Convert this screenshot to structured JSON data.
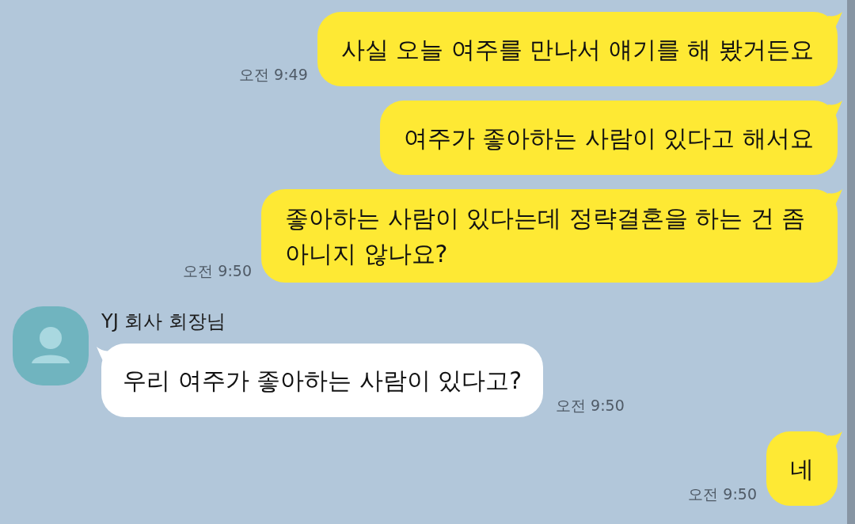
{
  "messages": [
    {
      "kind": "sent",
      "text": "사실 오늘 여주를 만나서 얘기를 해 봤거든요",
      "time": "오전 9:49"
    },
    {
      "kind": "sent",
      "text": "여주가 좋아하는 사람이 있다고 해서요"
    },
    {
      "kind": "sent",
      "text": "좋아하는 사람이 있다는데 정략결혼을 하는 건 좀 아니지 않나요?",
      "time": "오전 9:50"
    },
    {
      "kind": "received",
      "sender": "YJ 회사 회장님",
      "text": "우리 여주가 좋아하는 사람이 있다고?",
      "time": "오전 9:50"
    },
    {
      "kind": "sent",
      "text": "네",
      "time": "오전 9:50"
    }
  ]
}
